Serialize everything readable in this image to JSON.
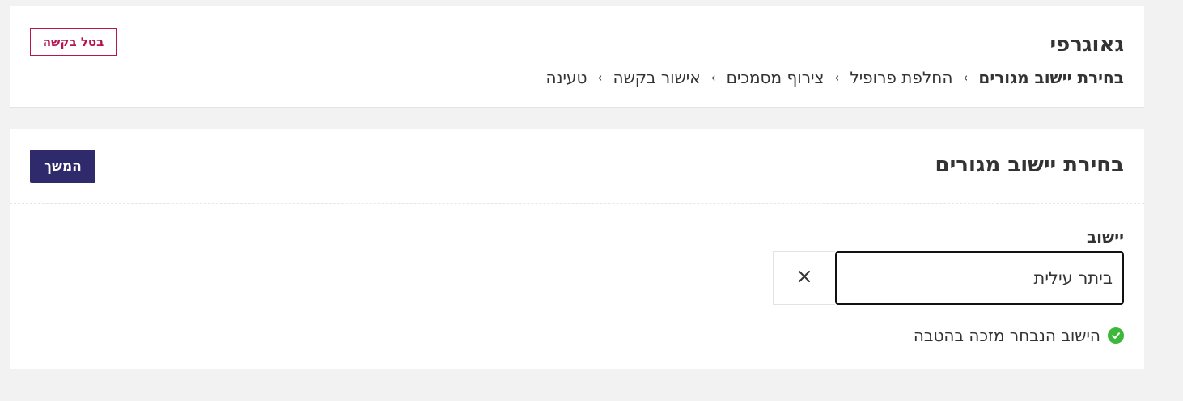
{
  "colors": {
    "primary": "#2e2a6b",
    "danger": "#b6164f",
    "success": "#3db83a",
    "background": "#f2f2f2"
  },
  "header": {
    "title": "גאוגרפי",
    "cancel_label": "בטל בקשה",
    "breadcrumb": [
      {
        "label": "בחירת יישוב מגורים",
        "current": true
      },
      {
        "label": "החלפת פרופיל",
        "current": false
      },
      {
        "label": "צירוף מסמכים",
        "current": false
      },
      {
        "label": "אישור בקשה",
        "current": false
      },
      {
        "label": "טעינה",
        "current": false
      }
    ],
    "separator": "›"
  },
  "main": {
    "title": "בחירת יישוב מגורים",
    "continue_label": "המשך",
    "field": {
      "label": "יישוב",
      "value": "ביתר עילית",
      "clear_icon": "close-icon"
    },
    "status": {
      "icon": "check-circle-icon",
      "text": "הישוב הנבחר מזכה בהטבה"
    }
  }
}
